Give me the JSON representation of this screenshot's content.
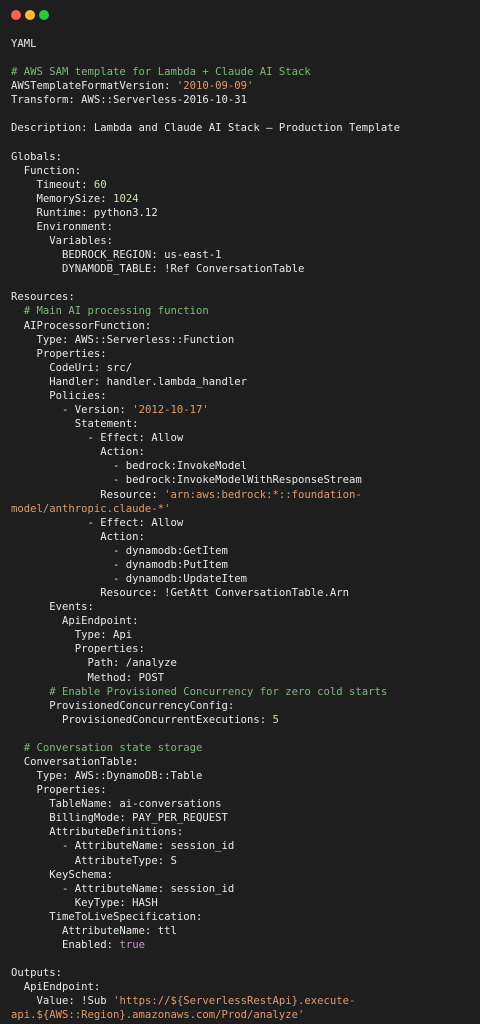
{
  "window": {
    "controls": [
      "close",
      "minimize",
      "maximize"
    ],
    "colors": {
      "close": "#ff5f57",
      "minimize": "#febc2e",
      "maximize": "#28c840",
      "background": "#1e1e1e"
    }
  },
  "code": {
    "language_label": "YAML",
    "lines": [
      [
        {
          "t": "YAML",
          "c": "lang"
        }
      ],
      [],
      [
        {
          "t": "# AWS SAM template for Lambda + Claude AI Stack",
          "c": "comment"
        }
      ],
      [
        {
          "t": "AWSTemplateFormatVersion: ",
          "c": ""
        },
        {
          "t": "'2010-09-09'",
          "c": "str"
        }
      ],
      [
        {
          "t": "Transform: AWS::Serverless-2016-10-31",
          "c": ""
        }
      ],
      [],
      [
        {
          "t": "Description: Lambda and Claude AI Stack – Production Template",
          "c": ""
        }
      ],
      [],
      [
        {
          "t": "Globals:",
          "c": ""
        }
      ],
      [
        {
          "t": "  Function:",
          "c": ""
        }
      ],
      [
        {
          "t": "    Timeout: ",
          "c": ""
        },
        {
          "t": "60",
          "c": "num"
        }
      ],
      [
        {
          "t": "    MemorySize: ",
          "c": ""
        },
        {
          "t": "1024",
          "c": "num"
        }
      ],
      [
        {
          "t": "    Runtime: python3.12",
          "c": ""
        }
      ],
      [
        {
          "t": "    Environment:",
          "c": ""
        }
      ],
      [
        {
          "t": "      Variables:",
          "c": ""
        }
      ],
      [
        {
          "t": "        BEDROCK_REGION: us-east-1",
          "c": ""
        }
      ],
      [
        {
          "t": "        DYNAMODB_TABLE: !Ref ConversationTable",
          "c": ""
        }
      ],
      [],
      [
        {
          "t": "Resources:",
          "c": ""
        }
      ],
      [
        {
          "t": "  # Main AI processing function",
          "c": "comment"
        }
      ],
      [
        {
          "t": "  AIProcessorFunction:",
          "c": ""
        }
      ],
      [
        {
          "t": "    Type: AWS::Serverless::Function",
          "c": ""
        }
      ],
      [
        {
          "t": "    Properties:",
          "c": ""
        }
      ],
      [
        {
          "t": "      CodeUri: src/",
          "c": ""
        }
      ],
      [
        {
          "t": "      Handler: handler.lambda_handler",
          "c": ""
        }
      ],
      [
        {
          "t": "      Policies:",
          "c": ""
        }
      ],
      [
        {
          "t": "        - Version: ",
          "c": ""
        },
        {
          "t": "'2012-10-17'",
          "c": "str"
        }
      ],
      [
        {
          "t": "          Statement:",
          "c": ""
        }
      ],
      [
        {
          "t": "            - Effect: Allow",
          "c": ""
        }
      ],
      [
        {
          "t": "              Action:",
          "c": ""
        }
      ],
      [
        {
          "t": "                - bedrock:InvokeModel",
          "c": ""
        }
      ],
      [
        {
          "t": "                - bedrock:InvokeModelWithResponseStream",
          "c": ""
        }
      ],
      [
        {
          "t": "              Resource: ",
          "c": ""
        },
        {
          "t": "'arn:aws:bedrock:*::foundation-",
          "c": "str"
        }
      ],
      [
        {
          "t": "model/anthropic.claude-*'",
          "c": "str"
        }
      ],
      [
        {
          "t": "            - Effect: Allow",
          "c": ""
        }
      ],
      [
        {
          "t": "              Action:",
          "c": ""
        }
      ],
      [
        {
          "t": "                - dynamodb:GetItem",
          "c": ""
        }
      ],
      [
        {
          "t": "                - dynamodb:PutItem",
          "c": ""
        }
      ],
      [
        {
          "t": "                - dynamodb:UpdateItem",
          "c": ""
        }
      ],
      [
        {
          "t": "              Resource: !GetAtt ConversationTable.Arn",
          "c": ""
        }
      ],
      [
        {
          "t": "      Events:",
          "c": ""
        }
      ],
      [
        {
          "t": "        ApiEndpoint:",
          "c": ""
        }
      ],
      [
        {
          "t": "          Type: Api",
          "c": ""
        }
      ],
      [
        {
          "t": "          Properties:",
          "c": ""
        }
      ],
      [
        {
          "t": "            Path: /analyze",
          "c": ""
        }
      ],
      [
        {
          "t": "            Method: POST",
          "c": ""
        }
      ],
      [
        {
          "t": "      # Enable Provisioned Concurrency for zero cold starts",
          "c": "comment"
        }
      ],
      [
        {
          "t": "      ProvisionedConcurrencyConfig:",
          "c": ""
        }
      ],
      [
        {
          "t": "        ProvisionedConcurrentExecutions: ",
          "c": ""
        },
        {
          "t": "5",
          "c": "num"
        }
      ],
      [],
      [
        {
          "t": "  # Conversation state storage",
          "c": "comment"
        }
      ],
      [
        {
          "t": "  ConversationTable:",
          "c": ""
        }
      ],
      [
        {
          "t": "    Type: AWS::DynamoDB::Table",
          "c": ""
        }
      ],
      [
        {
          "t": "    Properties:",
          "c": ""
        }
      ],
      [
        {
          "t": "      TableName: ai-conversations",
          "c": ""
        }
      ],
      [
        {
          "t": "      BillingMode: PAY_PER_REQUEST",
          "c": ""
        }
      ],
      [
        {
          "t": "      AttributeDefinitions:",
          "c": ""
        }
      ],
      [
        {
          "t": "        - AttributeName: session_id",
          "c": ""
        }
      ],
      [
        {
          "t": "          AttributeType: S",
          "c": ""
        }
      ],
      [
        {
          "t": "      KeySchema:",
          "c": ""
        }
      ],
      [
        {
          "t": "        - AttributeName: session_id",
          "c": ""
        }
      ],
      [
        {
          "t": "          KeyType: HASH",
          "c": ""
        }
      ],
      [
        {
          "t": "      TimeToLiveSpecification:",
          "c": ""
        }
      ],
      [
        {
          "t": "        AttributeName: ttl",
          "c": ""
        }
      ],
      [
        {
          "t": "        Enabled: ",
          "c": ""
        },
        {
          "t": "true",
          "c": "bool"
        }
      ],
      [],
      [
        {
          "t": "Outputs:",
          "c": ""
        }
      ],
      [
        {
          "t": "  ApiEndpoint:",
          "c": ""
        }
      ],
      [
        {
          "t": "    Value: !Sub ",
          "c": ""
        },
        {
          "t": "'https://${ServerlessRestApi}.execute-",
          "c": "str"
        }
      ],
      [
        {
          "t": "api.${AWS::Region}.amazonaws.com/Prod/analyze'",
          "c": "str"
        }
      ]
    ]
  }
}
